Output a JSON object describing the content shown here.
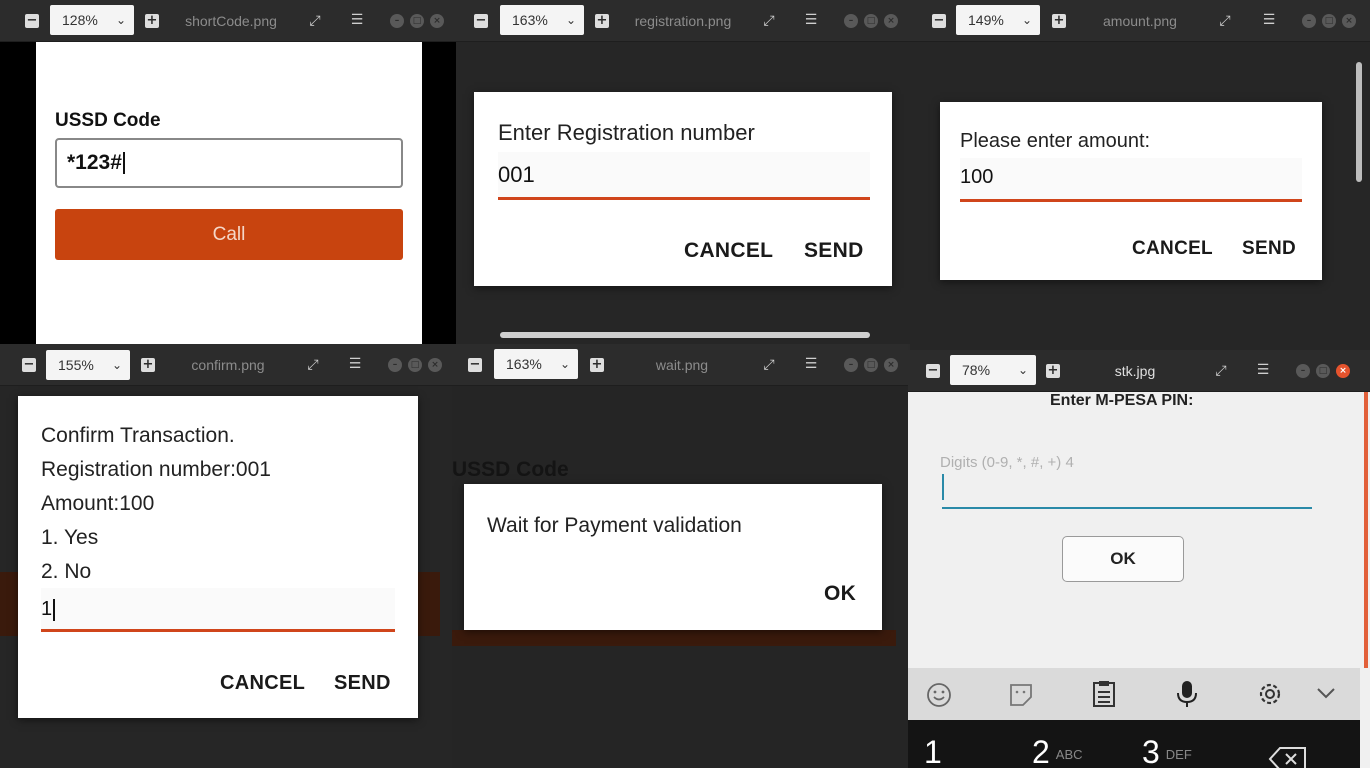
{
  "windows": {
    "shortcode": {
      "zoom": "128%",
      "filename": "shortCode.png",
      "label": "USSD Code",
      "input_value": "*123#",
      "call_label": "Call"
    },
    "registration": {
      "zoom": "163%",
      "filename": "registration.png",
      "title": "Enter Registration number",
      "value": "001",
      "cancel_label": "CANCEL",
      "send_label": "SEND"
    },
    "amount": {
      "zoom": "149%",
      "filename": "amount.png",
      "title": "Please enter amount:",
      "value": "100",
      "cancel_label": "CANCEL",
      "send_label": "SEND"
    },
    "confirm": {
      "zoom": "155%",
      "filename": "confirm.png",
      "lines": [
        "Confirm Transaction.",
        "Registration number:001",
        "Amount:100",
        "1. Yes",
        "2. No"
      ],
      "value": "1",
      "cancel_label": "CANCEL",
      "send_label": "SEND"
    },
    "wait": {
      "zoom": "163%",
      "filename": "wait.png",
      "bg_label": "USSD Code",
      "message": "Wait for Payment validation",
      "ok_label": "OK"
    },
    "stk": {
      "zoom": "78%",
      "filename": "stk.jpg",
      "title": "Enter M-PESA PIN:",
      "placeholder": "Digits (0-9, *, #, +) 4",
      "ok_label": "OK",
      "keys": [
        {
          "digit": "1",
          "letters": ""
        },
        {
          "digit": "2",
          "letters": "ABC"
        },
        {
          "digit": "3",
          "letters": "DEF"
        }
      ]
    }
  },
  "colors": {
    "accent": "#c8440f",
    "underline": "#d0451b",
    "stk_underline": "#2a8aa8"
  },
  "icons": [
    "zoom-out-icon",
    "zoom-in-icon",
    "fullscreen-icon",
    "menu-icon",
    "minimize-icon",
    "maximize-icon",
    "close-icon",
    "chevron-down-icon",
    "emoji-icon",
    "sticker-icon",
    "clipboard-icon",
    "microphone-icon",
    "settings-icon",
    "backspace-icon"
  ]
}
